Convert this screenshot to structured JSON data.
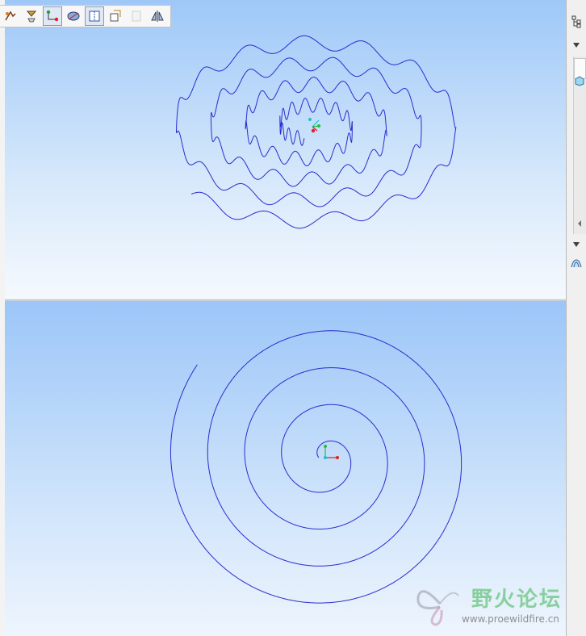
{
  "toolbar": {
    "buttons": [
      {
        "name": "sketch-tool-icon",
        "active": false,
        "disabled": false
      },
      {
        "name": "datum-plane-icon",
        "active": false,
        "disabled": false
      },
      {
        "name": "curve-points-icon",
        "active": true,
        "disabled": false
      },
      {
        "name": "view-orientation-icon",
        "active": false,
        "disabled": false
      },
      {
        "name": "sketch-view-icon",
        "active": true,
        "disabled": false
      },
      {
        "name": "copy-sketch-icon",
        "active": false,
        "disabled": false
      },
      {
        "name": "placeholder-icon",
        "active": false,
        "disabled": true
      },
      {
        "name": "mirror-icon",
        "active": false,
        "disabled": false
      }
    ]
  },
  "right_panel": {
    "items": [
      "tree-icon",
      "dropdown-arrow-icon",
      "model-icon",
      "scroll-left-icon",
      "dropdown-arrow-icon",
      "surface-icon"
    ]
  },
  "top_view": {
    "curve_color": "#2b2bd0",
    "spiral": {
      "turns": 4.1,
      "wave_count": 60,
      "start_angle_deg": 100
    }
  },
  "bottom_view": {
    "curve_color": "#2b2bd0",
    "spiral": {
      "turns": 4.1,
      "start_angle_deg": 180
    }
  },
  "axes": {
    "x_color": "#e02020",
    "y_color": "#20c040",
    "z_color": "#20c0d0"
  },
  "watermark": {
    "title": "野火论坛",
    "url": "www.proewildfire.cn"
  }
}
